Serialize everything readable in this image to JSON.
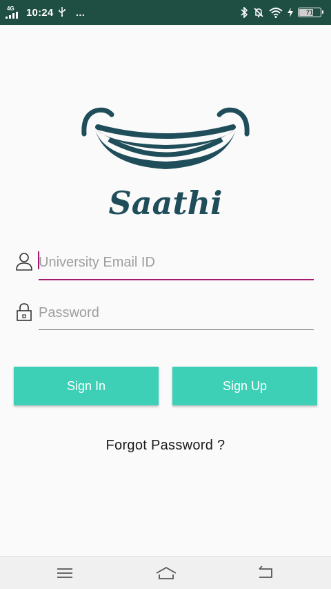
{
  "status_bar": {
    "network_label": "4G",
    "time": "10:24",
    "usb_icon": "usb-icon",
    "more_icon": "…",
    "battery_level": 71,
    "battery_text": "71",
    "background": "#1f4e43"
  },
  "logo": {
    "brand_text": "Saathi",
    "color": "#1f4e5a"
  },
  "login": {
    "email_placeholder": "University Email ID",
    "email_value": "",
    "password_placeholder": "Password",
    "password_value": "",
    "accent_color": "#a0186f"
  },
  "buttons": {
    "sign_in": "Sign In",
    "sign_up": "Sign Up",
    "color": "#3dd0b6"
  },
  "forgot_password": "Forgot Password ?",
  "nav_bar": {
    "menu_icon": "menu-icon",
    "home_icon": "home-icon",
    "back_icon": "back-icon"
  }
}
